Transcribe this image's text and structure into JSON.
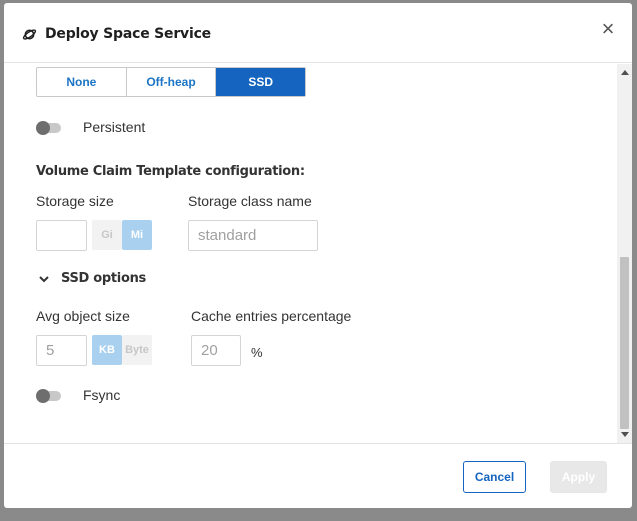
{
  "dialog": {
    "title": "Deploy Space Service",
    "close_label": "×"
  },
  "memory_mode": {
    "options": [
      "None",
      "Off-heap",
      "SSD"
    ],
    "selected": "SSD"
  },
  "persistent": {
    "label": "Persistent",
    "on": false
  },
  "volume_claim": {
    "title": "Volume Claim Template configuration:",
    "storage_size_label": "Storage size",
    "storage_size_value": "",
    "storage_units": [
      "Gi",
      "Mi"
    ],
    "storage_unit_selected": "Mi",
    "storage_class_label": "Storage class name",
    "storage_class_placeholder": "standard"
  },
  "ssd_options": {
    "title": "SSD options",
    "avg_object_size_label": "Avg object size",
    "avg_object_size_placeholder": "5",
    "size_units": [
      "KB",
      "Byte"
    ],
    "size_unit_selected": "KB",
    "cache_label": "Cache entries percentage",
    "cache_placeholder": "20",
    "cache_unit": "%"
  },
  "fsync": {
    "label": "Fsync",
    "on": false
  },
  "footer": {
    "cancel_label": "Cancel",
    "apply_label": "Apply"
  },
  "colors": {
    "primary": "#1565c0",
    "unit_active": "#a9d0ee",
    "backdrop": "#8a8a8a"
  },
  "icons": {
    "logo": "planet-icon",
    "close": "close-icon",
    "chevron": "chevron-down-icon"
  }
}
